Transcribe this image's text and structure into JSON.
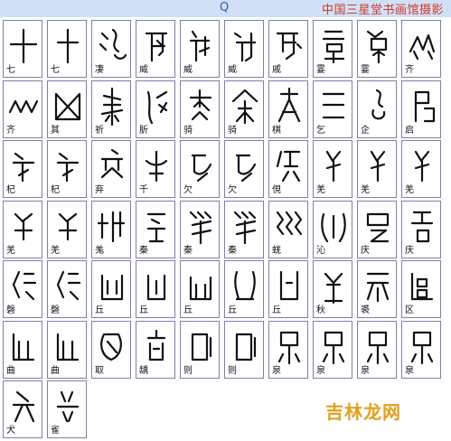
{
  "header": {
    "search_letter": "Q",
    "site_title": "中国三星堂书画馆摄影"
  },
  "characters": [
    "七",
    "七",
    "凄",
    "威",
    "威",
    "威",
    "戚",
    "霎",
    "霎",
    "齐",
    "齐",
    "其",
    "祈",
    "肵",
    "骑",
    "骑",
    "棋",
    "乞",
    "企",
    "启",
    "杞",
    "杞",
    "弃",
    "千",
    "欠",
    "欠",
    "俔",
    "羌",
    "羌",
    "羌",
    "羌",
    "羌",
    "羗",
    "秦",
    "秦",
    "秦",
    "蜣",
    "沁",
    "庆",
    "庆",
    "磬",
    "磬",
    "丘",
    "丘",
    "丘",
    "丘",
    "丘",
    "秋",
    "裘",
    "区",
    "曲",
    "曲",
    "取",
    "龋",
    "则",
    "则",
    "泉",
    "泉",
    "泉",
    "泉",
    "犬",
    "雀"
  ],
  "watermark": {
    "text": "吉林龙网"
  }
}
